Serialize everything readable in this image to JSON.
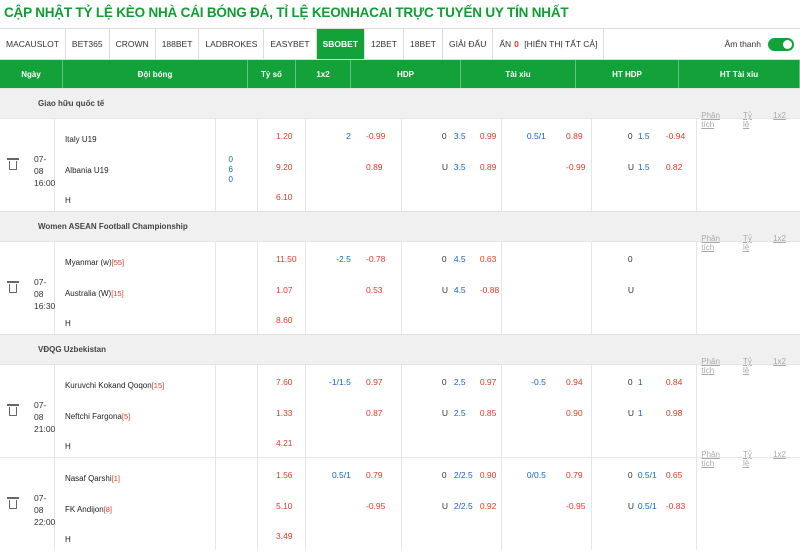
{
  "page_title": "CẬP NHẬT TỶ LỆ KÈO NHÀ CÁI BÓNG ĐÁ, TỈ LỆ KEONHACAI TRỰC TUYẾN UY TÍN NHẤT",
  "tabs": [
    {
      "label": "MACAUSLOT"
    },
    {
      "label": "BET365"
    },
    {
      "label": "CROWN"
    },
    {
      "label": "188BET"
    },
    {
      "label": "LADBROKES"
    },
    {
      "label": "EASYBET"
    },
    {
      "label": "SBOBET",
      "active": true
    },
    {
      "label": "12BET"
    },
    {
      "label": "18BET"
    },
    {
      "label": "GIẢI ĐẤU"
    }
  ],
  "hidden": {
    "label": "ẨN",
    "count": "0",
    "show_all": "[HIỂN THỊ TẤT CẢ]"
  },
  "sound": {
    "label": "Âm thanh",
    "on": true
  },
  "colors": {
    "brand": "#13a23a",
    "odds_red": "#e23b2a",
    "handicap_blue": "#1565c0"
  },
  "columns": {
    "date": "Ngày",
    "team": "Đội bóng",
    "score": "Tỷ số",
    "x12": "1x2",
    "hdp": "HDP",
    "tx": "Tài xỉu",
    "ht_hdp": "HT HDP",
    "ht_tx": "HT Tài xỉu"
  },
  "links": {
    "analysis": "Phân tích",
    "odds": "Tỷ lệ",
    "x12": "1x2"
  },
  "leagues": [
    {
      "name": "Giao hữu quốc tế",
      "matches": [
        {
          "date": "07-08",
          "time": "16:00",
          "home": "Italy U19",
          "home_rank": "",
          "away": "Albania U19",
          "away_rank": "",
          "draw_label": "H",
          "score": [
            "0",
            "6",
            "0"
          ],
          "x12": [
            "1.20",
            "9.20",
            "6.10"
          ],
          "hdp": {
            "line_home": "2",
            "line_away": "",
            "odds_home": "-0.99",
            "odds_away": "0.89"
          },
          "tx": {
            "line": "3.5",
            "o_label": "0",
            "u_label": "U",
            "odds_over": "0.99",
            "odds_under": "0.89"
          },
          "ht_hdp": {
            "line_home": "0.5/1",
            "line_away": "",
            "odds_home": "0.89",
            "odds_away": "-0.99"
          },
          "ht_tx": {
            "line": "1.5",
            "o_label": "0",
            "u_label": "U",
            "odds_over": "-0.94",
            "odds_under": "0.82"
          }
        }
      ]
    },
    {
      "name": "Women ASEAN Football Championship",
      "matches": [
        {
          "date": "07-08",
          "time": "16:30",
          "home": "Myanmar (w)",
          "home_rank": "[55]",
          "away": "Australia (W)",
          "away_rank": "[15]",
          "draw_label": "H",
          "score": [
            "",
            "",
            ""
          ],
          "x12": [
            "11.50",
            "1.07",
            "8.60"
          ],
          "hdp": {
            "line_home": "-2.5",
            "line_away": "",
            "odds_home": "-0.78",
            "odds_away": "0.53"
          },
          "tx": {
            "line": "4.5",
            "o_label": "0",
            "u_label": "U",
            "odds_over": "0.63",
            "odds_under": "-0.88"
          },
          "ht_hdp": {
            "line_home": "",
            "line_away": "",
            "odds_home": "",
            "odds_away": ""
          },
          "ht_tx": {
            "line": "",
            "o_label": "0",
            "u_label": "U",
            "odds_over": "",
            "odds_under": ""
          }
        }
      ]
    },
    {
      "name": "VĐQG Uzbekistan",
      "matches": [
        {
          "date": "07-08",
          "time": "21:00",
          "home": "Kuruvchi Kokand Qoqon",
          "home_rank": "[15]",
          "away": "Neftchi Fargona",
          "away_rank": "[5]",
          "draw_label": "H",
          "score": [
            "",
            "",
            ""
          ],
          "x12": [
            "7.60",
            "1.33",
            "4.21"
          ],
          "hdp": {
            "line_home": "-1/1.5",
            "line_away": "",
            "odds_home": "0.97",
            "odds_away": "0.87"
          },
          "tx": {
            "line": "2.5",
            "o_label": "0",
            "u_label": "U",
            "odds_over": "0.97",
            "odds_under": "0.85"
          },
          "ht_hdp": {
            "line_home": "-0.5",
            "line_away": "",
            "odds_home": "0.94",
            "odds_away": "0.90"
          },
          "ht_tx": {
            "line": "1",
            "o_label": "0",
            "u_label": "U",
            "odds_over": "0.84",
            "odds_under": "0.98"
          }
        },
        {
          "date": "07-08",
          "time": "22:00",
          "home": "Nasaf Qarshi",
          "home_rank": "[1]",
          "away": "FK Andijon",
          "away_rank": "[8]",
          "draw_label": "H",
          "score": [
            "",
            "",
            ""
          ],
          "x12": [
            "1.56",
            "5.10",
            "3.49"
          ],
          "hdp": {
            "line_home": "0.5/1",
            "line_away": "",
            "odds_home": "0.79",
            "odds_away": "-0.95"
          },
          "tx": {
            "line": "2/2.5",
            "o_label": "0",
            "u_label": "U",
            "odds_over": "0.90",
            "odds_under": "0.92"
          },
          "ht_hdp": {
            "line_home": "0/0.5",
            "line_away": "",
            "odds_home": "0.79",
            "odds_away": "-0.95"
          },
          "ht_tx": {
            "line": "0.5/1",
            "o_label": "0",
            "u_label": "U",
            "odds_over": "0.65",
            "odds_under": "-0.83"
          }
        }
      ]
    }
  ]
}
